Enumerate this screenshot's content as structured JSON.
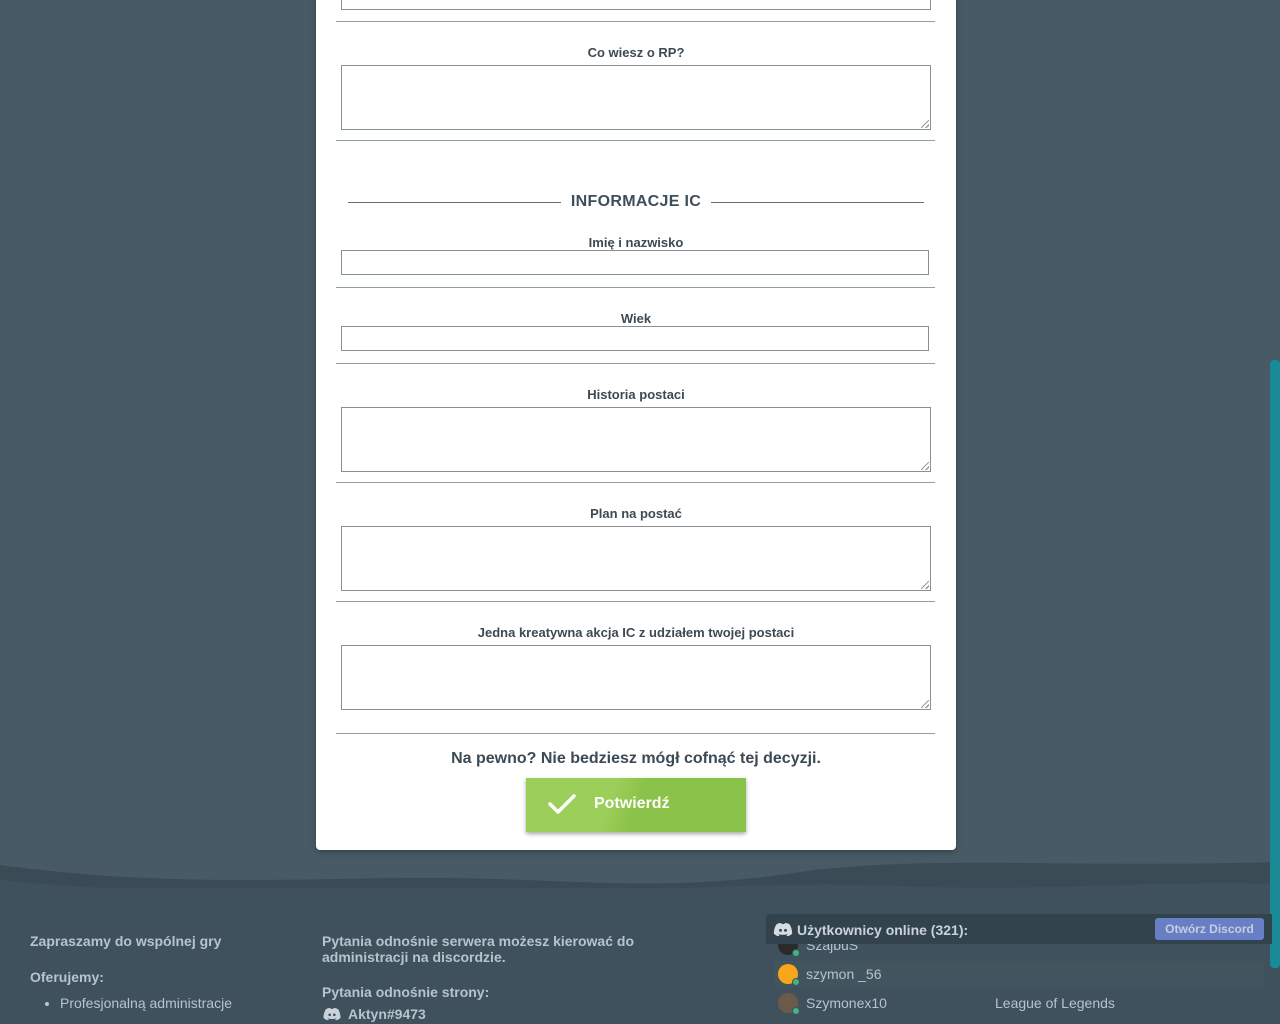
{
  "form": {
    "q_rp": {
      "label": "Co wiesz o RP?"
    },
    "section_ic": {
      "title": "INFORMACJE IC"
    },
    "ic_name": {
      "label": "Imię i nazwisko"
    },
    "ic_age": {
      "label": "Wiek"
    },
    "ic_history": {
      "label": "Historia postaci"
    },
    "ic_plan": {
      "label": "Plan na postać"
    },
    "ic_action": {
      "label": "Jedna kreatywna akcja IC z udziałem twojej postaci"
    },
    "confirm_text": "Na pewno? Nie bedziesz mógł cofnąć tej decyzji.",
    "confirm_button": "Potwierdź"
  },
  "footer": {
    "col1": {
      "heading": "Zapraszamy do wspólnej gry",
      "offer_heading": "Oferujemy:",
      "offers": [
        "Profesjonalną administracje"
      ]
    },
    "col2": {
      "server_q": "Pytania odnośnie serwera możesz kierować do administracji na discordzie.",
      "site_q": "Pytania odnośnie strony:",
      "admin": "Aktyn#9473"
    },
    "discord": {
      "title": "Użytkownicy online (321):",
      "open_button": "Otwórz Discord",
      "members": [
        {
          "name": "SzajbuS",
          "game": ""
        },
        {
          "name": "szymon _56",
          "game": ""
        },
        {
          "name": "Szymonex10",
          "game": "League of Legends"
        }
      ]
    }
  },
  "colors": {
    "page_bg": "#475a66",
    "button_green": "#8bc34a",
    "discord_blurple": "#7289da",
    "scrollbar": "#1a8a96"
  }
}
